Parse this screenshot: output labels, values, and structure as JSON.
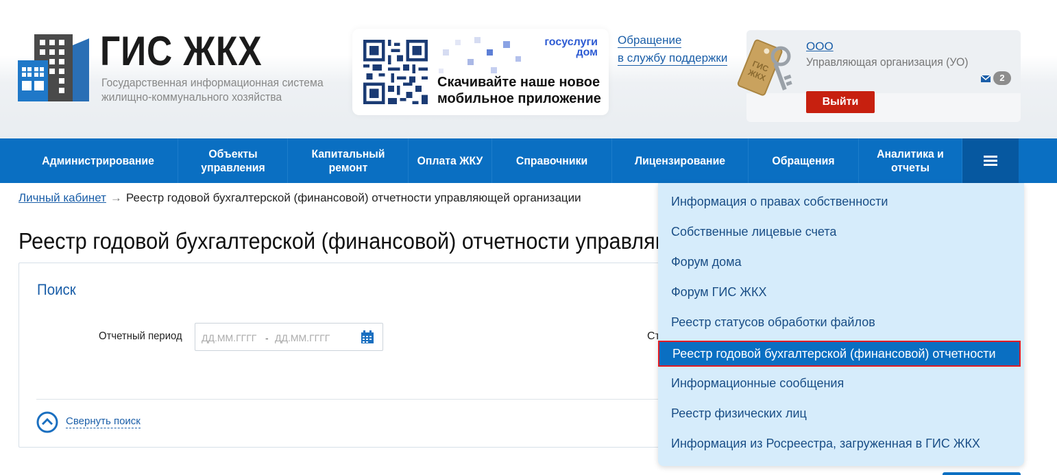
{
  "header": {
    "logo_title": "ГИС ЖКХ",
    "logo_subtitle_line1": "Государственная информационная система",
    "logo_subtitle_line2": "жилищно-коммунального хозяйства",
    "promo": {
      "brand_line1": "госуслуги",
      "brand_line2": "дом",
      "text_line1": "Скачивайте наше новое",
      "text_line2": "мобильное приложение"
    },
    "support_line1": "Обращение",
    "support_line2": "в службу поддержки",
    "user": {
      "org_name": "ООО",
      "org_type": "Управляющая организация (УО)",
      "messages_count": "2",
      "logout_label": "Выйти"
    }
  },
  "nav": {
    "items": [
      {
        "label": "Администрирование"
      },
      {
        "label": "Объекты управления"
      },
      {
        "label": "Капитальный ремонт"
      },
      {
        "label": "Оплата ЖКУ"
      },
      {
        "label": "Справочники"
      },
      {
        "label": "Лицензирование"
      },
      {
        "label": "Обращения"
      },
      {
        "label": "Аналитика и отчеты"
      }
    ]
  },
  "breadcrumb": {
    "home": "Личный кабинет",
    "arrow": "→",
    "current": "Реестр годовой бухгалтерской (финансовой) отчетности управляющей организации"
  },
  "page_title": "Реестр годовой бухгалтерской (финансовой) отчетности управляющей организации",
  "search": {
    "title": "Поиск",
    "period_label": "Отчетный период",
    "date_from_placeholder": "ДД.ММ.ГГГГ",
    "date_separator": "-",
    "date_to_placeholder": "ДД.ММ.ГГГГ",
    "status_label": "Ст",
    "collapse_label": "Свернуть поиск"
  },
  "dropdown": {
    "items": [
      {
        "label": "Информация о правах собственности"
      },
      {
        "label": "Собственные лицевые счета"
      },
      {
        "label": "Форум дома"
      },
      {
        "label": "Форум ГИС ЖКХ"
      },
      {
        "label": "Реестр статусов обработки файлов"
      },
      {
        "label": "Реестр годовой бухгалтерской (финансовой) отчетности"
      },
      {
        "label": "Информационные сообщения"
      },
      {
        "label": "Реестр физических лиц"
      },
      {
        "label": "Информация из Росреестра, загруженная в ГИС ЖКХ"
      }
    ],
    "active_index": 5
  },
  "colors": {
    "nav_bg": "#0a6fc2",
    "link": "#1a5ea8",
    "logout": "#c7200f",
    "dropdown_bg": "#d6ecfb",
    "highlight_border": "#e31b23"
  }
}
